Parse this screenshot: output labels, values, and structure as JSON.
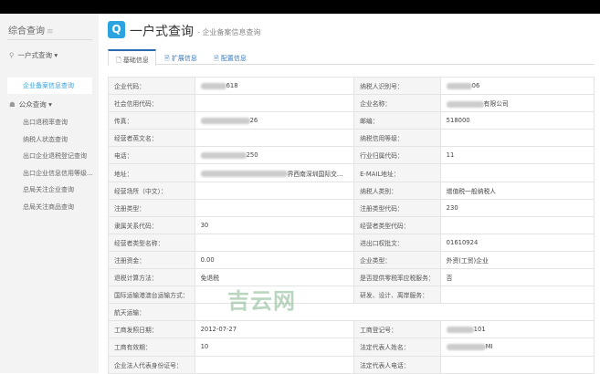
{
  "sidebar": {
    "title": "综合查询",
    "groups": [
      {
        "label": "一户式查询",
        "items": [
          "企业备案信息查询"
        ]
      },
      {
        "label": "公众查询",
        "items": [
          "出口退税率查询",
          "纳税人状态查询",
          "出口企业退税登记查询",
          "出口企业信息信用等级...",
          "总局关注企业查询",
          "总局关注商品查询"
        ]
      }
    ]
  },
  "header": {
    "title": "一户式查询",
    "subtitle": "- 企业备案信息查询"
  },
  "tabs": [
    "基础信息",
    "扩展信息",
    "配置信息"
  ],
  "rows": [
    [
      {
        "l": "企业代码：",
        "v": "618",
        "m": 1
      },
      {
        "l": "纳税人识别号：",
        "v": "06",
        "m": 1
      }
    ],
    [
      {
        "l": "社会信用代码：",
        "v": ""
      },
      {
        "l": "企业名称：",
        "v": "有限公司",
        "m": 1
      }
    ],
    [
      {
        "l": "传真：",
        "v": "26",
        "m": 1
      },
      {
        "l": "邮编：",
        "v": "518000"
      }
    ],
    [
      {
        "l": "经营者英文名：",
        "v": ""
      },
      {
        "l": "纳税信用等级：",
        "v": ""
      }
    ],
    [
      {
        "l": "电话：",
        "v": "250",
        "m": 1
      },
      {
        "l": "行业归属代码：",
        "v": "11"
      }
    ],
    [
      {
        "l": "地址：",
        "v": "界西南深圳国际交...",
        "m": 1
      },
      {
        "l": "E-MAIL地址：",
        "v": ""
      }
    ],
    [
      {
        "l": "经营场所（中文）：",
        "v": ""
      },
      {
        "l": "纳税人类别：",
        "v": "增值税一般纳税人"
      }
    ],
    [
      {
        "l": "注册类型：",
        "v": ""
      },
      {
        "l": "注册类型代码：",
        "v": "230"
      }
    ],
    [
      {
        "l": "隶属关系代码：",
        "v": "30"
      },
      {
        "l": "经营者类型代码：",
        "v": ""
      }
    ],
    [
      {
        "l": "经营者类型名称：",
        "v": ""
      },
      {
        "l": "进出口权批文：",
        "v": "01610924"
      }
    ],
    [
      {
        "l": "注册资金：",
        "v": "0.00"
      },
      {
        "l": "企业类型：",
        "v": "外资(工贸)企业"
      }
    ],
    [
      {
        "l": "退税计算方法：",
        "v": "免退税"
      },
      {
        "l": "是否提供零税率应税服务：",
        "v": "否"
      }
    ],
    [
      {
        "l": "国际运输港澳台运输方式：",
        "v": ""
      },
      {
        "l": "研发、设计、离岸服务：",
        "v": ""
      }
    ],
    [
      {
        "l": "航天运输：",
        "v": ""
      }
    ],
    [
      {
        "l": "工商发照日期：",
        "v": "2012-07-27"
      },
      {
        "l": "工商登记号：",
        "v": "101",
        "m": 1
      }
    ],
    [
      {
        "l": "工商有效期：",
        "v": "10"
      },
      {
        "l": "法定代表人姓名：",
        "v": "MI",
        "m": 1
      }
    ],
    [
      {
        "l": "企业法人代表身份证号：",
        "v": ""
      },
      {
        "l": "法定代表人电话：",
        "v": ""
      }
    ]
  ],
  "watermark": "吉云网"
}
